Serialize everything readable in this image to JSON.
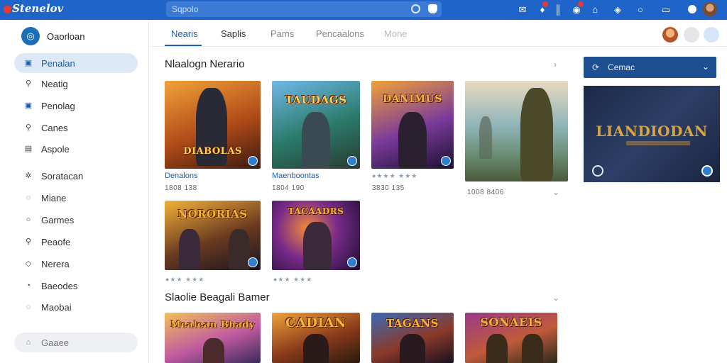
{
  "topbar": {
    "brand": "Stenelov",
    "search_placeholder": "Sqpolo",
    "accent": "#1f64c8"
  },
  "sidebar": {
    "title": "Oaorloan",
    "items": [
      {
        "label": "Penalan",
        "icon": "square-icon",
        "active": true
      },
      {
        "label": "Neatig",
        "icon": "search-icon"
      },
      {
        "label": "Penolag",
        "icon": "square-icon"
      },
      {
        "label": "Canes",
        "icon": "search-icon"
      },
      {
        "label": "Aspole",
        "icon": "document-icon"
      },
      {
        "label": "Soratacan",
        "icon": "puzzle-icon"
      },
      {
        "label": "Miane",
        "icon": "chat-icon"
      },
      {
        "label": "Garmes",
        "icon": "circle-icon"
      },
      {
        "label": "Peaofe",
        "icon": "search-icon"
      },
      {
        "label": "Nerera",
        "icon": "shield-icon"
      },
      {
        "label": "Baeodes",
        "icon": "compass-icon"
      },
      {
        "label": "Maobai",
        "icon": "chat-icon"
      }
    ],
    "footer_item": "Gaaee"
  },
  "tabs": [
    {
      "label": "Nearis",
      "active": true
    },
    {
      "label": "Saplis"
    },
    {
      "label": "Pams"
    },
    {
      "label": "Pencaalons"
    },
    {
      "label": "Mone"
    }
  ],
  "section1": {
    "title": "Nlaalogn Nerario",
    "cards": [
      {
        "art": "DIABOLAS",
        "label": "Denalons",
        "meta": "1808 138"
      },
      {
        "art": "TAUDAGS",
        "label": "Maenboontas",
        "meta": "1804 190"
      },
      {
        "art": "DANIMUS",
        "label": "",
        "meta": "3830 135"
      },
      {
        "art": "",
        "label": "",
        "meta": "1008 8406"
      },
      {
        "art": "NORORIAS",
        "label": "",
        "meta": ""
      },
      {
        "art": "TACAADRS",
        "label": "",
        "meta": ""
      }
    ]
  },
  "section2": {
    "title": "Slaolie Beagali Bamer",
    "cards": [
      {
        "art": "Mealean Bhady"
      },
      {
        "art": "CADIAN"
      },
      {
        "art": "TAGANS"
      },
      {
        "art": "SONAEIS"
      }
    ]
  },
  "right_panel": {
    "dropdown_label": "Cemac",
    "banner_text": "LIANDIODAN"
  }
}
